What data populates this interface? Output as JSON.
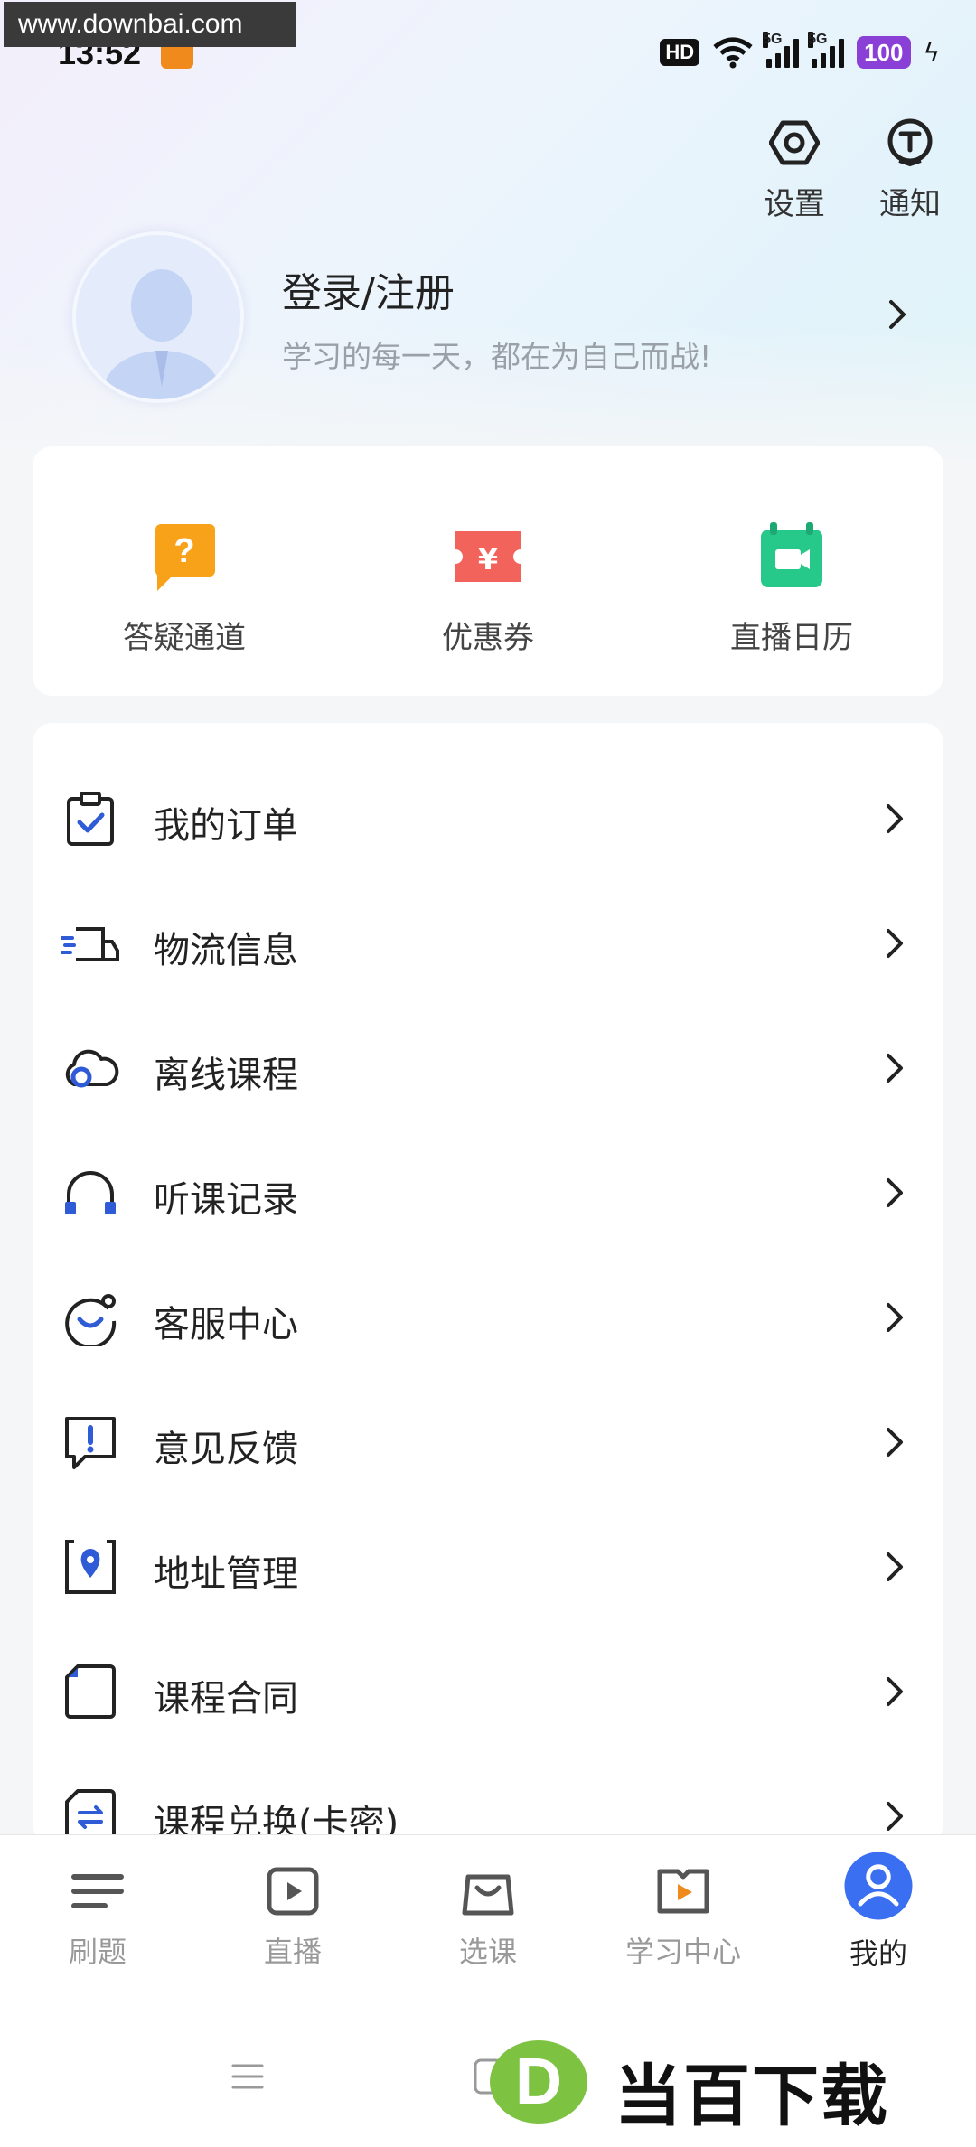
{
  "watermark": {
    "top_text": "www.downbai.com",
    "bottom_text": "当百下载",
    "bottom_logo_letter": "D"
  },
  "status_bar": {
    "time": "13:52",
    "hd": "HD",
    "hd_sub": "1 2",
    "net1": "5G",
    "net2": "5G",
    "battery": "100"
  },
  "header": {
    "settings_label": "设置",
    "notify_label": "通知"
  },
  "profile": {
    "name": "登录/注册",
    "motto": "学习的每一天，都在为自己而战!"
  },
  "quick_actions": [
    {
      "label": "答疑通道",
      "icon": "question-bubble-icon",
      "color": "#f8a21a"
    },
    {
      "label": "优惠券",
      "icon": "coupon-icon",
      "color": "#f2645b"
    },
    {
      "label": "直播日历",
      "icon": "live-calendar-icon",
      "color": "#27c98a"
    }
  ],
  "menu": [
    {
      "label": "我的订单",
      "icon": "clipboard-check-icon"
    },
    {
      "label": "物流信息",
      "icon": "delivery-truck-icon"
    },
    {
      "label": "离线课程",
      "icon": "cloud-icon"
    },
    {
      "label": "听课记录",
      "icon": "headphones-icon"
    },
    {
      "label": "客服中心",
      "icon": "customer-service-icon"
    },
    {
      "label": "意见反馈",
      "icon": "feedback-icon"
    },
    {
      "label": "地址管理",
      "icon": "location-pin-icon"
    },
    {
      "label": "课程合同",
      "icon": "contract-document-icon"
    },
    {
      "label": "课程兑换(卡密)",
      "icon": "exchange-card-icon"
    }
  ],
  "bottom_nav": [
    {
      "label": "刷题",
      "icon": "list-lines-icon",
      "active": false
    },
    {
      "label": "直播",
      "icon": "live-play-icon",
      "active": false
    },
    {
      "label": "选课",
      "icon": "shopping-bag-icon",
      "active": false
    },
    {
      "label": "学习中心",
      "icon": "study-center-icon",
      "active": false
    },
    {
      "label": "我的",
      "icon": "user-profile-icon",
      "active": true
    }
  ],
  "colors": {
    "accent": "#3a6ff2",
    "menu_icon_blue": "#2f5bd6",
    "text_dark": "#222222",
    "text_muted": "#9aa0a8"
  }
}
